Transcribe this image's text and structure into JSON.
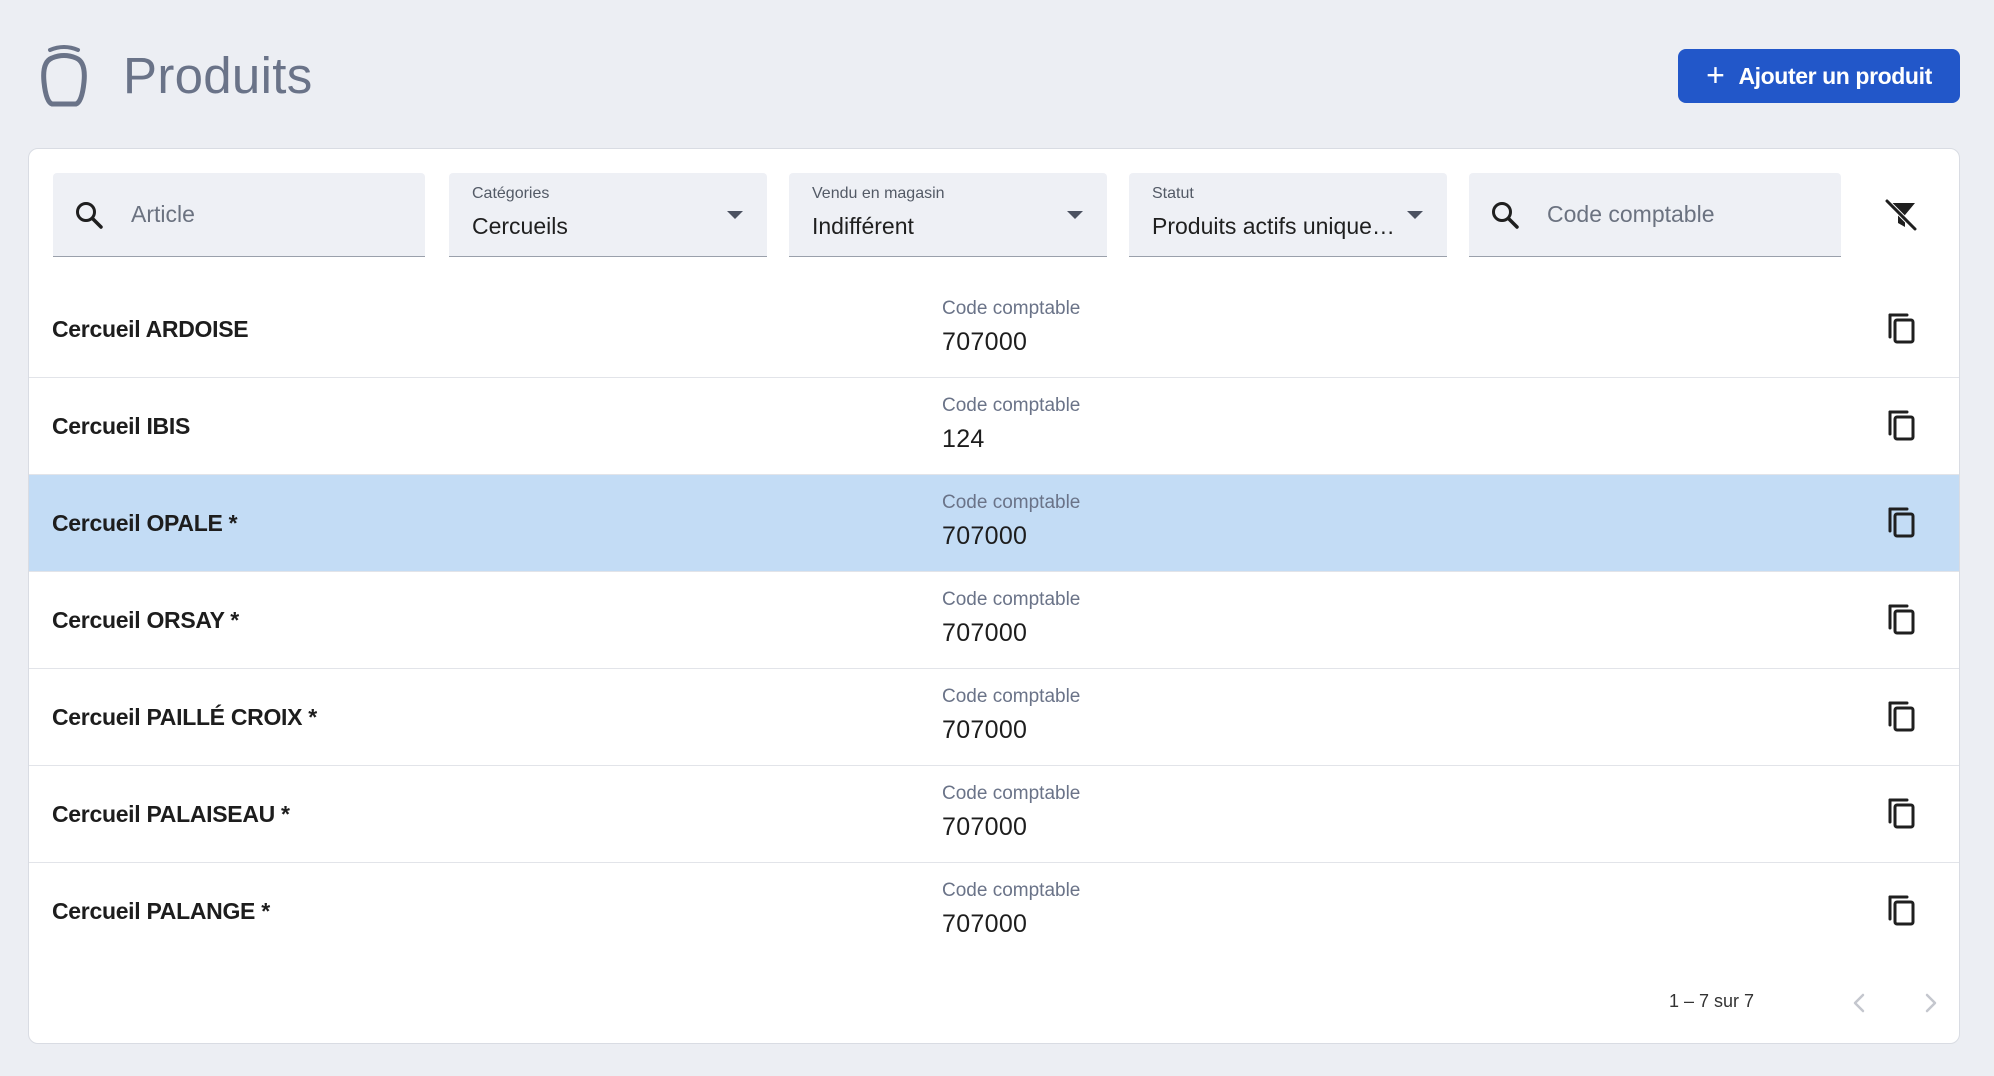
{
  "header": {
    "title": "Produits",
    "add_button_label": "Ajouter un produit",
    "add_button_icon": "plus-icon",
    "logo_icon": "urn-icon"
  },
  "filters": {
    "article": {
      "placeholder": "Article",
      "value": ""
    },
    "categories": {
      "label": "Catégories",
      "value": "Cercueils"
    },
    "vendu_en_magasin": {
      "label": "Vendu en magasin",
      "value": "Indifférent"
    },
    "statut": {
      "label": "Statut",
      "value": "Produits actifs uniquement"
    },
    "code_comptable": {
      "placeholder": "Code comptable",
      "value": ""
    },
    "clear_filters_icon": "filter-off-icon"
  },
  "products": [
    {
      "name": "Cercueil ARDOISE",
      "code_label": "Code comptable",
      "code": "707000",
      "selected": false
    },
    {
      "name": "Cercueil IBIS",
      "code_label": "Code comptable",
      "code": "124",
      "selected": false
    },
    {
      "name": "Cercueil OPALE *",
      "code_label": "Code comptable",
      "code": "707000",
      "selected": true
    },
    {
      "name": "Cercueil ORSAY *",
      "code_label": "Code comptable",
      "code": "707000",
      "selected": false
    },
    {
      "name": "Cercueil PAILLÉ CROIX *",
      "code_label": "Code comptable",
      "code": "707000",
      "selected": false
    },
    {
      "name": "Cercueil PALAISEAU *",
      "code_label": "Code comptable",
      "code": "707000",
      "selected": false
    },
    {
      "name": "Cercueil PALANGE *",
      "code_label": "Code comptable",
      "code": "707000",
      "selected": false
    }
  ],
  "paginator": {
    "range_label": "1 – 7 sur 7",
    "prev_icon": "chevron-left-icon",
    "next_icon": "chevron-right-icon"
  },
  "colors": {
    "background": "#eceef3",
    "primary": "#2257c9",
    "selected_row": "#c3dcf5",
    "muted_text": "#6a7388"
  }
}
